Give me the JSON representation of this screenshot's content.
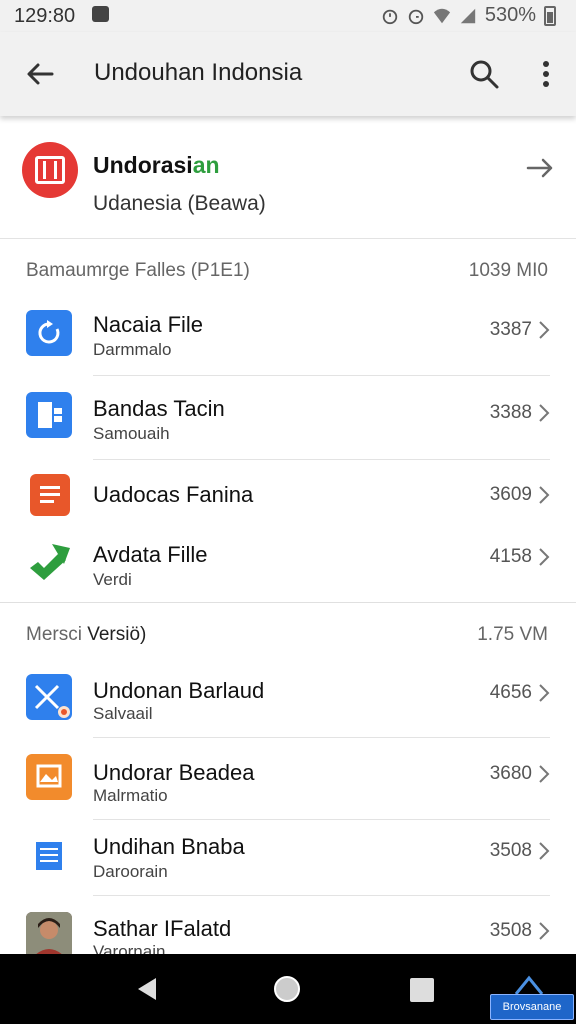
{
  "status_bar": {
    "time": "129:80",
    "battery": "530%",
    "icons": [
      "notification-icon",
      "alarm-icon",
      "alarm-icon",
      "wifi-icon",
      "signal-icon",
      "battery-icon"
    ]
  },
  "toolbar": {
    "title": "Undouhan Indonsia",
    "icons": [
      "back-arrow-icon",
      "search-icon",
      "more-vert-icon"
    ]
  },
  "app_header": {
    "name_black": "Undorasi",
    "name_green": "an",
    "subtitle": "Udanesia (Beawa)",
    "accent_color": "#2e9e3e",
    "logo_color": "#e53935"
  },
  "section1": {
    "label": "Bamaumrge Falles (P1E1)",
    "right": "1039 MI0",
    "items": [
      {
        "title": "Nacaia File",
        "sub": "Darmmalo",
        "value": "3387",
        "icon": "blue-refresh-icon",
        "color": "#2f80ed"
      },
      {
        "title": "Bandas Tacin",
        "sub": "Samouaih",
        "value": "3388",
        "icon": "blue-doc-icon",
        "color": "#2f80ed"
      },
      {
        "title": "Uadocas Fanina",
        "sub": "",
        "value": "3609",
        "icon": "orange-doc-icon",
        "color": "#e8572a"
      },
      {
        "title": "Avdata Fille",
        "sub": "Verdi",
        "value": "4158",
        "icon": "green-arrow-icon",
        "color": "#2e9e3e"
      }
    ]
  },
  "section2": {
    "label_a": "Mersci",
    "label_b": "Versi",
    "label_c": "ö)",
    "right": "1.75 VM",
    "items": [
      {
        "title": "Undonan Barlaud",
        "sub": "Salvaail",
        "value": "4656",
        "icon": "blue-x-icon",
        "color": "#2f80ed"
      },
      {
        "title": "Undorar Beadea",
        "sub": "Malrmatio",
        "value": "3680",
        "icon": "orange-image-icon",
        "color": "#f28b2c"
      },
      {
        "title": "Undihan Bnaba",
        "sub": "Daroorain",
        "value": "3508",
        "icon": "blue-doc-icon",
        "color": "#2f80ed"
      },
      {
        "title": "Sathar IFalatd",
        "sub": "Varornain",
        "value": "3508",
        "icon": "avatar-photo-icon",
        "color": "#6d4c41"
      }
    ]
  },
  "nav": {
    "badge": "Brovsanane",
    "icons": [
      "nav-back-icon",
      "nav-home-icon",
      "nav-recent-icon"
    ]
  }
}
